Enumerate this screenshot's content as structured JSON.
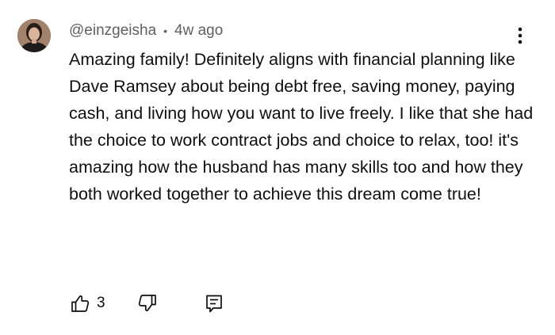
{
  "comment": {
    "author": "@einzgeisha",
    "separator": "•",
    "time_ago": "4w ago",
    "text": "Amazing family! Definitely aligns with financial planning like Dave Ramsey about being debt free, saving money, paying cash, and living how you want to live freely. I like that she had the choice to work contract jobs and choice to relax, too! it's amazing how the husband has many skills too and how they both worked together to achieve this dream come true!",
    "likes": "3"
  },
  "icons": {
    "avatar": "user-avatar",
    "menu": "more-vertical-icon",
    "like": "thumbs-up-icon",
    "dislike": "thumbs-down-icon",
    "reply": "reply-comment-icon"
  }
}
